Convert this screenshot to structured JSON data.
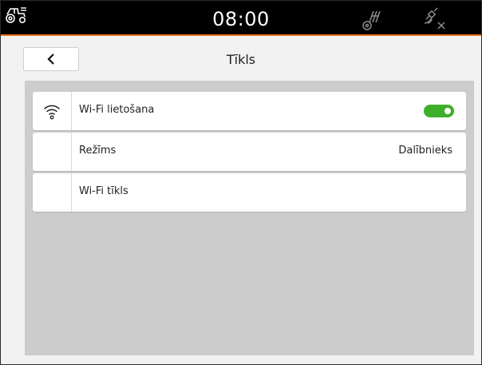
{
  "status_bar": {
    "time": "08:00",
    "icons": [
      "tractor-icon",
      "gps-steering-icon",
      "satellite-disconnected-icon"
    ]
  },
  "header": {
    "back_icon": "chevron-left-icon",
    "title": "Tīkls"
  },
  "settings": [
    {
      "icon": "wifi-icon",
      "label": "Wi-Fi lietošana",
      "control": "toggle",
      "enabled": true
    },
    {
      "icon": "",
      "label": "Režīms",
      "value": "Dalībnieks"
    },
    {
      "icon": "",
      "label": "Wi-Fi tīkls",
      "value": ""
    }
  ],
  "colors": {
    "status_bar": "#000000",
    "accent": "#e8721c",
    "toggle_on": "#3fae2a",
    "content_bg": "#cccccc"
  }
}
